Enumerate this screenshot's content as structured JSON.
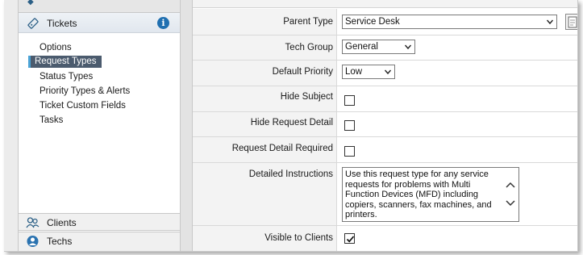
{
  "sidebar": {
    "section": {
      "label": "Tickets",
      "info_glyph": "i"
    },
    "items": [
      {
        "label": "Options"
      },
      {
        "label": "Request Types"
      },
      {
        "label": "Status Types"
      },
      {
        "label": "Priority Types & Alerts"
      },
      {
        "label": "Ticket Custom Fields"
      },
      {
        "label": "Tasks"
      }
    ],
    "nav": [
      {
        "label": "Clients",
        "icon": "clients-icon"
      },
      {
        "label": "Techs",
        "icon": "techs-icon"
      }
    ]
  },
  "form": {
    "parent_type": {
      "label": "Parent Type",
      "value": "Service Desk"
    },
    "tech_group": {
      "label": "Tech Group",
      "value": "General"
    },
    "default_priority": {
      "label": "Default Priority",
      "value": "Low"
    },
    "hide_subject": {
      "label": "Hide Subject",
      "checked": false
    },
    "hide_request_detail": {
      "label": "Hide Request Detail",
      "checked": false
    },
    "request_detail_required": {
      "label": "Request Detail Required",
      "checked": false
    },
    "detailed_instructions": {
      "label": "Detailed Instructions",
      "value": "Use this request type for any service requests for problems with Multi Function Devices (MFD) including copiers, scanners, fax machines, and printers."
    },
    "visible_to_clients": {
      "label": "Visible to Clients",
      "checked": true
    }
  },
  "colors": {
    "accent": "#1f6fb0",
    "selected_bg": "#4b5b6e",
    "selected_bar": "#4ba3d6",
    "label_bg": "#f3f3f3"
  }
}
